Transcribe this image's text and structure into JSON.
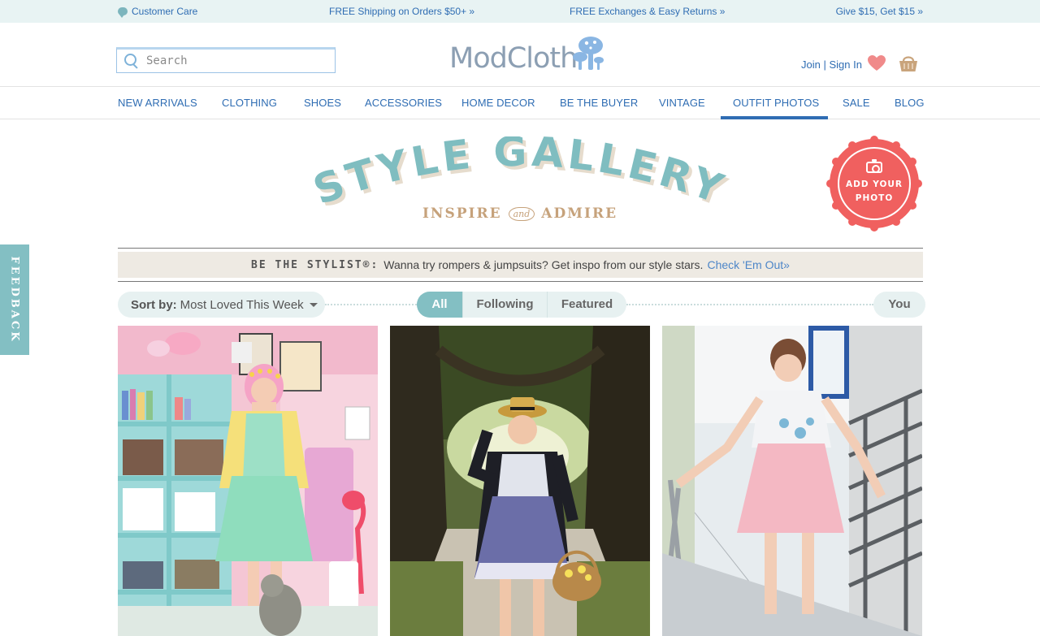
{
  "topbar": {
    "customer_care": "Customer Care",
    "promo_shipping": "FREE Shipping on Orders $50+ »",
    "promo_exchanges": "FREE Exchanges & Easy Returns »",
    "promo_referral": "Give $15, Get $15 »"
  },
  "header": {
    "search_placeholder": "Search",
    "logo_text": "ModCloth",
    "account_link": "Join | Sign In",
    "icons": [
      "search-icon",
      "mushroom-logo-icon",
      "heart-icon",
      "basket-icon"
    ]
  },
  "nav": {
    "items": [
      "NEW ARRIVALS",
      "CLOTHING",
      "SHOES",
      "ACCESSORIES",
      "HOME DECOR",
      "BE THE BUYER",
      "VINTAGE",
      "OUTFIT PHOTOS",
      "SALE",
      "BLOG"
    ],
    "active": "OUTFIT PHOTOS"
  },
  "gallery": {
    "title": "STYLE GALLERY",
    "subtitle_left": "INSPIRE",
    "subtitle_and": "and",
    "subtitle_right": "ADMIRE",
    "add_photo_line1": "ADD YOUR",
    "add_photo_line2": "PHOTO"
  },
  "banner": {
    "lead": "BE THE STYLIST®:",
    "text": "Wanna try rompers & jumpsuits? Get inspo from our style stars.",
    "link": "Check 'Em Out»"
  },
  "filters": {
    "sort_label": "Sort by:",
    "sort_value": "Most Loved This Week",
    "tabs": [
      "All",
      "Following",
      "Featured"
    ],
    "active_tab": "All",
    "you": "You"
  },
  "feedback": "FEEDBACK",
  "colors": {
    "brand_blue": "#2f6db3",
    "teal": "#83bfc3",
    "coral": "#f0605f",
    "tan": "#c6a27b"
  }
}
